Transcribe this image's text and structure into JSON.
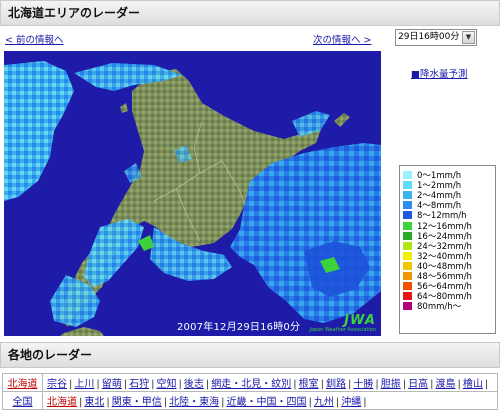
{
  "header": {
    "title": "北海道エリアのレーダー"
  },
  "nav": {
    "prev": "< 前の情報へ",
    "next": "次の情報へ >"
  },
  "time_select": {
    "value": "29日16時00分"
  },
  "map": {
    "timestamp": "2007年12月29日16時0分",
    "logo_big": "JWA",
    "logo_small": "Japan Weather Association"
  },
  "precip_link": "■降水量予測",
  "legend": [
    {
      "label": "0〜1mm/h",
      "color": "#9ef0ff"
    },
    {
      "label": "1〜2mm/h",
      "color": "#5fdcf8"
    },
    {
      "label": "2〜4mm/h",
      "color": "#3cb4f0"
    },
    {
      "label": "4〜8mm/h",
      "color": "#2d8cf0"
    },
    {
      "label": "8〜12mm/h",
      "color": "#1e5ae6"
    },
    {
      "label": "12〜16mm/h",
      "color": "#3cd23c"
    },
    {
      "label": "16〜24mm/h",
      "color": "#28aa28"
    },
    {
      "label": "24〜32mm/h",
      "color": "#b4e614"
    },
    {
      "label": "32〜40mm/h",
      "color": "#f0f000"
    },
    {
      "label": "40〜48mm/h",
      "color": "#f0c800"
    },
    {
      "label": "48〜56mm/h",
      "color": "#f09600"
    },
    {
      "label": "56〜64mm/h",
      "color": "#f05000"
    },
    {
      "label": "64〜80mm/h",
      "color": "#e61414"
    },
    {
      "label": "80mm/h〜",
      "color": "#b40078"
    }
  ],
  "section2": {
    "title": "各地のレーダー"
  },
  "local": {
    "head": "北海道",
    "links": [
      "宗谷",
      "上川",
      "留萌",
      "石狩",
      "空知",
      "後志",
      "網走・北見・紋別",
      "根室",
      "釧路",
      "十勝",
      "胆振",
      "日高",
      "渡島",
      "檜山"
    ]
  },
  "national": {
    "head": "全国",
    "links": [
      "北海道",
      "東北",
      "関東・甲信",
      "北陸・東海",
      "近畿・中国・四国",
      "九州",
      "沖縄"
    ]
  }
}
